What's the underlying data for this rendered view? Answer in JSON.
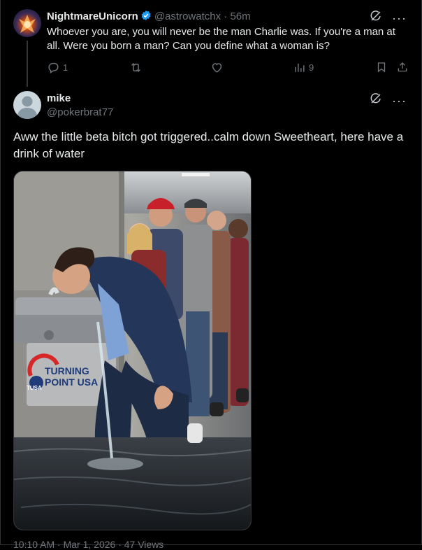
{
  "reply_tweet": {
    "display_name": "NightmareUnicorn",
    "handle": "@astrowatchx",
    "separator": "·",
    "time": "56m",
    "text": "Whoever you are, you will never be the man Charlie was. If you're a man at all. Were you born a man? Can you define what a woman is?",
    "reply_count": "1",
    "retweet_count": "",
    "like_count": "",
    "view_count": "9",
    "more_label": "···"
  },
  "main_tweet": {
    "display_name": "mike",
    "handle": "@pokerbrat77",
    "more_label": "···",
    "text": "Aww the little beta bitch got triggered..calm down Sweetheart, here have a drink of water",
    "image": {
      "sign_line1": "TURNING",
      "sign_line2": "POINT USA",
      "sign_badge": "TUSA"
    },
    "timestamp": "10:10 AM · Mar 1, 2026 · 47 Views"
  },
  "colors": {
    "background": "#000000",
    "text": "#e7e9ea",
    "muted": "#71767b",
    "verified": "#1d9bf0",
    "divider": "#2f3336"
  },
  "icons": [
    "verified-badge-icon",
    "grok-icon",
    "more-icon",
    "reply-icon",
    "retweet-icon",
    "like-icon",
    "views-icon",
    "bookmark-icon",
    "share-icon"
  ]
}
